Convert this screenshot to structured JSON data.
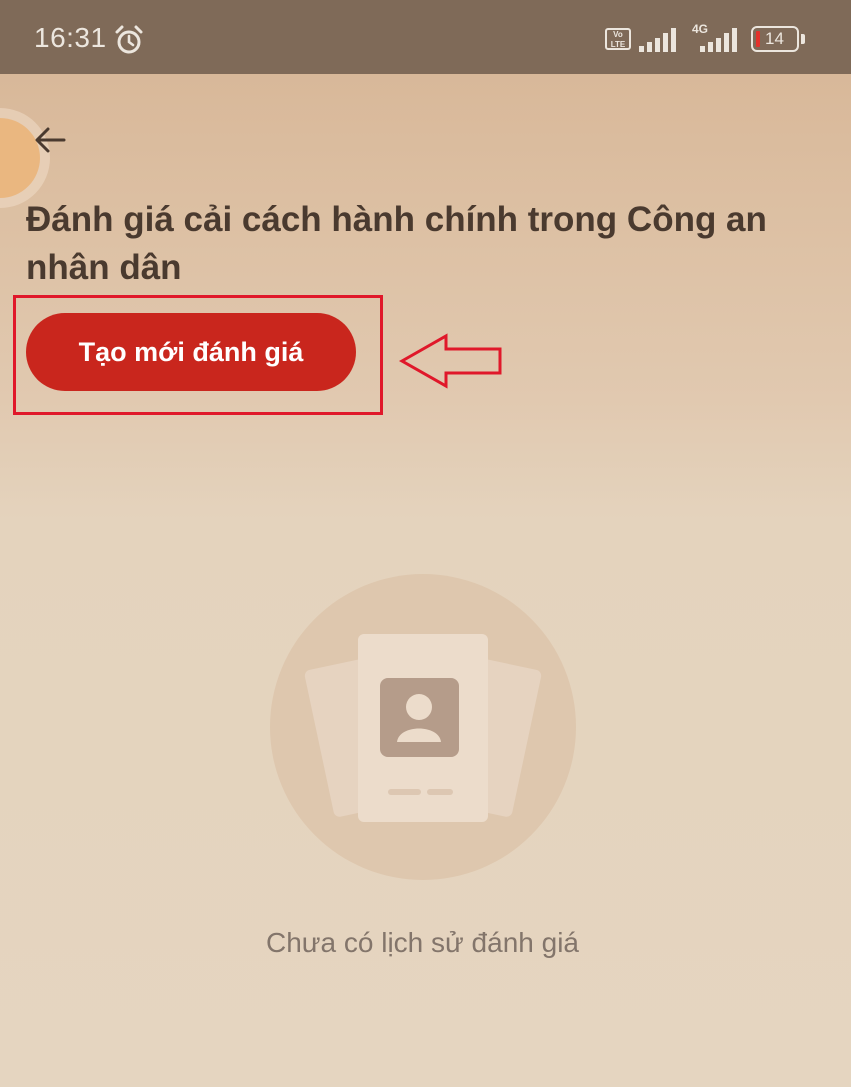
{
  "status_bar": {
    "time": "16:31",
    "volte_label": "Vo LTE",
    "network_type": "4G",
    "battery_level": "14",
    "icons": [
      "alarm-icon",
      "volte-icon",
      "signal-icon",
      "signal-4g-icon",
      "battery-icon"
    ]
  },
  "header": {
    "back_icon": "arrow-left-icon",
    "title": "Đánh giá cải cách hành chính trong Công an nhân dân"
  },
  "actions": {
    "create_label": "Tạo mới đánh giá"
  },
  "annotation": {
    "highlight_color": "#e0182a"
  },
  "empty_state": {
    "icon": "id-card-illustration",
    "message": "Chưa có lịch sử đánh giá"
  },
  "colors": {
    "primary": "#c9261d",
    "status_bar": "#7f6a58",
    "title_text": "#4a3a2f",
    "muted_text": "#83756b"
  }
}
